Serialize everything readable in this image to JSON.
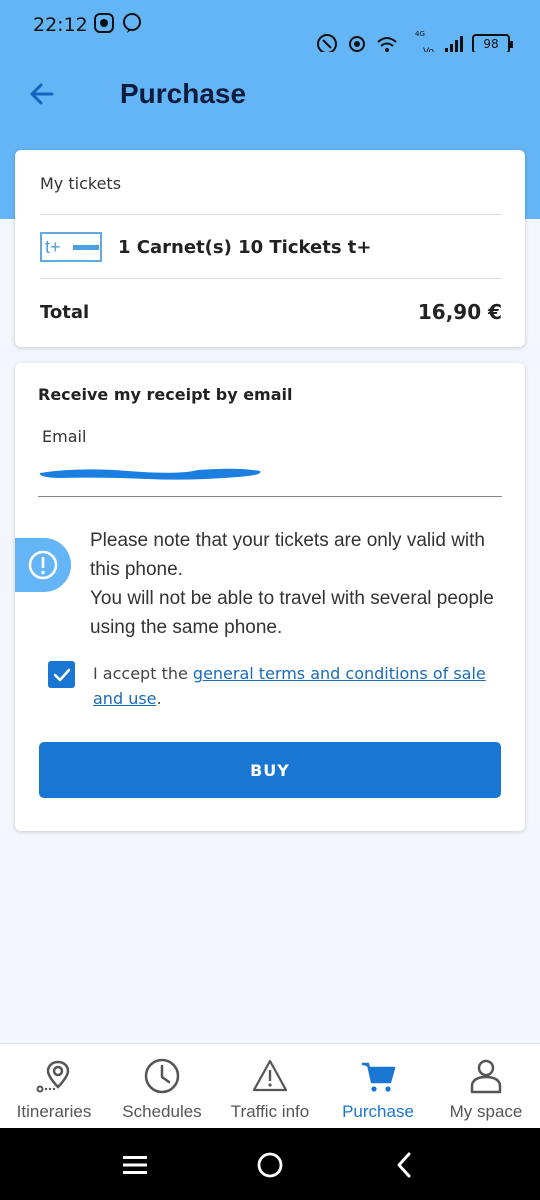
{
  "status_bar": {
    "time": "22:12",
    "network_top": "4G",
    "network_label": "Vo\nLTE",
    "battery": "98"
  },
  "header": {
    "title": "Purchase"
  },
  "tickets_card": {
    "heading": "My tickets",
    "ticket_icon_text": "t+",
    "ticket_label": "1 Carnet(s) 10 Tickets t+",
    "total_label": "Total",
    "total_value": "16,90 €"
  },
  "receipt_card": {
    "heading": "Receive my receipt by email",
    "email_label": "Email",
    "notice_line1": "Please note that your tickets are only valid with this phone.",
    "notice_line2": "You will not be able to travel with several people using the same phone.",
    "accept_prefix": "I accept the ",
    "terms_link": "general terms and conditions of sale and use",
    "accept_suffix": ".",
    "buy_label": "BUY"
  },
  "bottom_nav": {
    "items": [
      {
        "label": "Itineraries",
        "icon": "map-pin-icon"
      },
      {
        "label": "Schedules",
        "icon": "clock-icon"
      },
      {
        "label": "Traffic info",
        "icon": "warning-icon"
      },
      {
        "label": "Purchase",
        "icon": "cart-icon"
      },
      {
        "label": "My space",
        "icon": "person-icon"
      }
    ],
    "active": "Purchase"
  },
  "colors": {
    "accent": "#1976d2",
    "header_bg": "#64b5f6",
    "page_bg": "#f3f6fc"
  }
}
